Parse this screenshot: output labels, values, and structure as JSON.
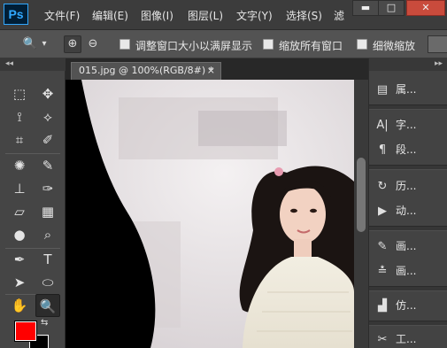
{
  "app": {
    "logo": "Ps"
  },
  "menu": {
    "items": [
      "文件(F)",
      "编辑(E)",
      "图像(I)",
      "图层(L)",
      "文字(Y)",
      "选择(S)",
      "滤"
    ],
    "window_buttons": {
      "minimize": "▬",
      "restore": "□",
      "close": "✕"
    }
  },
  "options_bar": {
    "tool_icon": "🔍",
    "dropdown": "▾",
    "zoom_in": "⊕",
    "zoom_out": "⊖",
    "options": [
      {
        "label": "调整窗口大小以满屏显示",
        "checked": false
      },
      {
        "label": "缩放所有窗口",
        "checked": false
      },
      {
        "label": "细微缩放",
        "checked": false
      }
    ]
  },
  "tools_panel": {
    "collapse": "◂◂",
    "rows": [
      [
        "⬚",
        "✥"
      ],
      [
        "⟟",
        "⟡"
      ],
      [
        "⌗",
        "✐"
      ],
      [
        "✺",
        "✎"
      ],
      [
        "⊥",
        "✑"
      ],
      [
        "▱",
        "▦"
      ],
      [
        "●",
        "⌕"
      ],
      [
        "✒",
        "T"
      ],
      [
        "➤",
        "⬭"
      ],
      [
        "✋",
        "🔍"
      ]
    ],
    "swap": "⇆"
  },
  "document": {
    "tab_title": "015.jpg @ 100%(RGB/8#) *",
    "tab_close": "×"
  },
  "panel_dock": {
    "expand": "▸▸",
    "groups": [
      [
        {
          "icon": "▤",
          "label": "属..."
        }
      ],
      [
        {
          "icon": "A|",
          "label": "字..."
        },
        {
          "icon": "¶",
          "label": "段..."
        }
      ],
      [
        {
          "icon": "↻",
          "label": "历..."
        },
        {
          "icon": "▶",
          "label": "动..."
        }
      ],
      [
        {
          "icon": "✎",
          "label": "画..."
        },
        {
          "icon": "≛",
          "label": "画..."
        }
      ],
      [
        {
          "icon": "▟",
          "label": "仿..."
        }
      ],
      [
        {
          "icon": "✂",
          "label": "工..."
        }
      ]
    ]
  },
  "colors": {
    "foreground": "#ff0000",
    "background": "#000000"
  }
}
